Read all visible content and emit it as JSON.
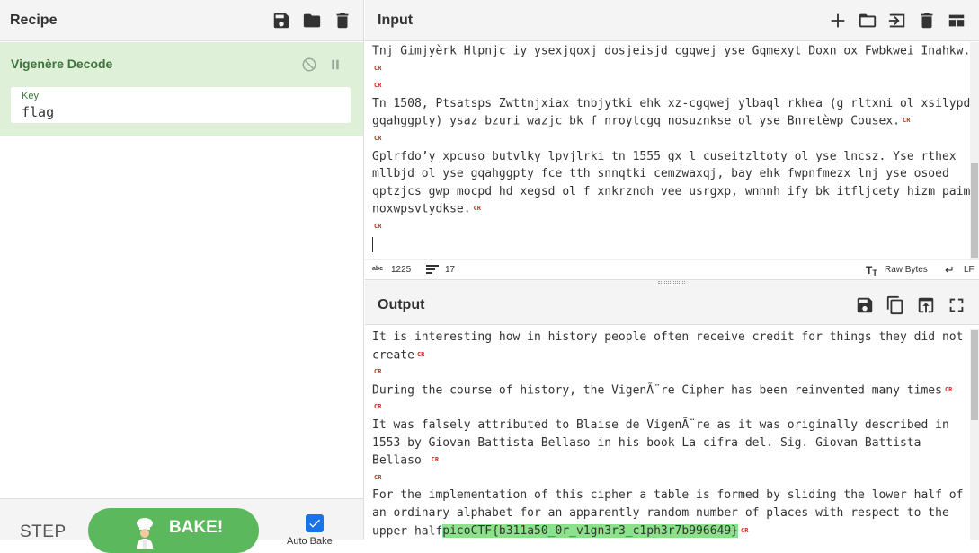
{
  "recipe": {
    "title": "Recipe",
    "icons": [
      "save-icon",
      "folder-icon",
      "trash-icon"
    ],
    "operation": {
      "name": "Vigenère Decode",
      "key_label": "Key",
      "key_value": "flag"
    },
    "step_label": "STEP",
    "bake_label": "BAKE!",
    "autobake_label": "Auto Bake",
    "autobake_checked": true
  },
  "input": {
    "title": "Input",
    "icons": [
      "plus-icon",
      "folder-icon",
      "import-icon",
      "trash-icon",
      "layout-icon"
    ],
    "lines": [
      "Tnj Gimjyèrk Htpnjc iy ysexjqoxj dosjeisjd cgqwej yse Gqmexyt Doxn ox Fwbkwei Inahkw.",
      "",
      "Tn 1508, Ptsatsps Zwttnjxiax tnbjytki ehk xz-cgqwej ylbaql rkhea (g rltxni ol xsilypd",
      "gqahggpty) ysaz bzuri wazjc bk f nroytcgq nosuznkse ol yse Bnretèwp Cousex.",
      "",
      "Gplrfdo’y xpcuso butvlky lpvjlrki tn 1555 gx l cuseitzltoty ol yse lncsz. Yse rthex",
      "mllbjd ol yse gqahggpty fce tth snnqtki cemzwaxqj, bay ehk fwpnfmezx lnj yse osoed",
      "qptzjcs gwp mocpd hd xegsd ol f xnkrznoh vee usrgxp, wnnnh ify bk itfljcety hizm paim",
      "noxwpsvtydkse."
    ],
    "cr_marker": "CR",
    "status": {
      "chars_icon": "abc",
      "chars": "1225",
      "lines_count": "17",
      "encoding": "Raw Bytes",
      "eol": "LF"
    }
  },
  "output": {
    "title": "Output",
    "icons": [
      "save-icon",
      "copy-icon",
      "replace-input-icon",
      "maximise-icon"
    ],
    "lines": [
      "It is interesting how in history people often receive credit for things they did not",
      "create",
      "During the course of history, the VigenÃ¨re Cipher has been reinvented many times",
      "It was falsely attributed to Blaise de VigenÃ¨re as it was originally described in",
      "1553 by Giovan Battista Bellaso in his book La cifra del. Sig. Giovan Battista",
      "Bellaso ",
      "For the implementation of this cipher a table is formed by sliding the lower half of",
      "an ordinary alphabet for an apparently random number of places with respect to the",
      "upper half"
    ],
    "flag": "picoCTF{b311a50_0r_v1gn3r3_c1ph3r7b996649}"
  },
  "colors": {
    "op_bg": "#dff0d8",
    "op_text": "#3c763d",
    "bake_bg": "#5cb85c",
    "cr_red": "#e02020",
    "highlight": "#8be28b"
  }
}
